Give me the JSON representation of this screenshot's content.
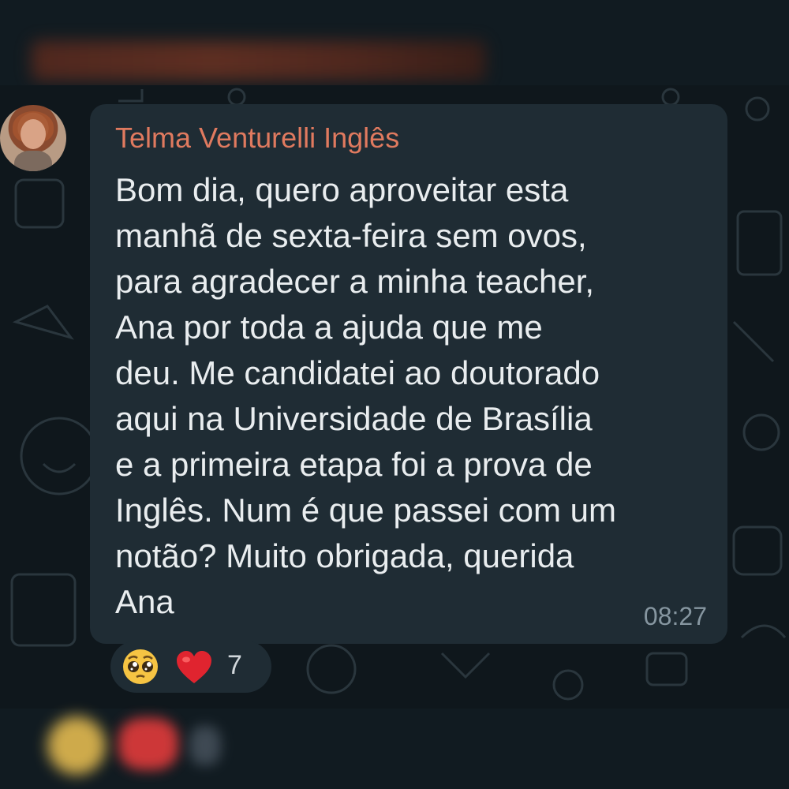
{
  "chat": {
    "sender_name": "Telma Venturelli Inglês",
    "message_lines": [
      "Bom dia, quero aproveitar esta",
      "manhã de sexta-feira sem ovos,",
      "para agradecer a minha teacher,",
      "Ana por toda a ajuda que me",
      "deu. Me candidatei ao doutorado",
      "aqui na Universidade de Brasília",
      "e a primeira etapa foi a prova de",
      "Inglês. Num é que passei com um",
      "notão? Muito obrigada, querida",
      "Ana"
    ],
    "timestamp": "08:27",
    "avatar_icon": "user-avatar-photo"
  },
  "reactions": {
    "emojis": [
      "pleading-face-icon",
      "red-heart-icon"
    ],
    "count": "7"
  },
  "colors": {
    "background": "#0b141a",
    "bubble": "#1f2c34",
    "sender_name": "#e07a5f",
    "message_text": "#e9edef",
    "timestamp": "#8696a0"
  }
}
